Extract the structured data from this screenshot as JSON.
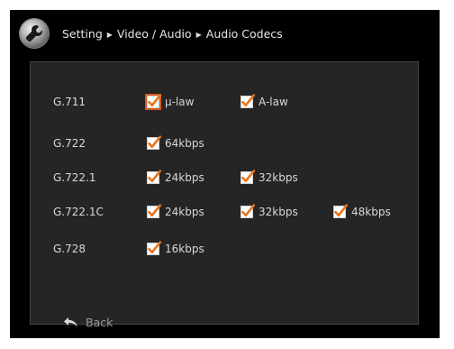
{
  "header": {
    "breadcrumb": [
      "Setting",
      "Video / Audio",
      "Audio Codecs"
    ],
    "settings_icon": "wrench-icon"
  },
  "codecs": [
    {
      "name": "G.711",
      "options": [
        {
          "label": "μ-law",
          "checked": true,
          "focused": true
        },
        {
          "label": "A-law",
          "checked": true
        }
      ]
    },
    {
      "name": "G.722",
      "options": [
        {
          "label": "64kbps",
          "checked": true
        }
      ]
    },
    {
      "name": "G.722.1",
      "options": [
        {
          "label": "24kbps",
          "checked": true
        },
        {
          "label": "32kbps",
          "checked": true
        }
      ]
    },
    {
      "name": "G.722.1C",
      "options": [
        {
          "label": "24kbps",
          "checked": true
        },
        {
          "label": "32kbps",
          "checked": true
        },
        {
          "label": "48kbps",
          "checked": true
        }
      ]
    },
    {
      "name": "G.728",
      "options": [
        {
          "label": "16kbps",
          "checked": true
        }
      ]
    }
  ],
  "footer": {
    "back_label": "Back",
    "back_icon": "back-arrow-icon"
  },
  "colors": {
    "background": "#000000",
    "panel": "#252525",
    "text": "#d8d8d8",
    "checkmark": "#e8741c",
    "focus_ring": "#d25a1e"
  }
}
